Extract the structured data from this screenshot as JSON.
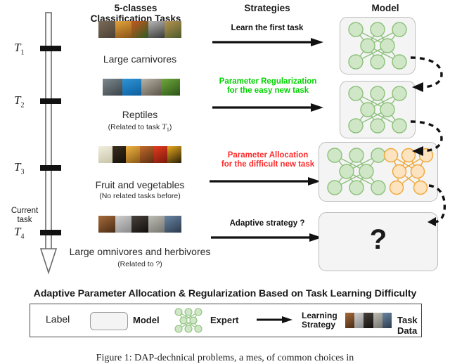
{
  "headers": {
    "tasks": "5-classes\nClassification Tasks",
    "tasks_line1": "5-classes",
    "tasks_line2": "Classification Tasks",
    "strategies": "Strategies",
    "model": "Model"
  },
  "timeline": {
    "current_task_line1": "Current",
    "current_task_line2": "task",
    "ticks": [
      {
        "label": "T",
        "sub": "1"
      },
      {
        "label": "T",
        "sub": "2"
      },
      {
        "label": "T",
        "sub": "3"
      },
      {
        "label": "T",
        "sub": "4"
      }
    ]
  },
  "tasks": [
    {
      "name": "Large carnivores",
      "note": "",
      "thumbs": [
        "#6d5f50",
        "#d08a28",
        "#b24a22",
        "#8c8c8c",
        "#a07f3e"
      ]
    },
    {
      "name": "Reptiles",
      "note": "(Related to task T₁)",
      "note_prefix": "(Related to task ",
      "note_sym": "T",
      "note_sub": "1",
      "note_suffix": ")",
      "thumbs": [
        "#5d6b72",
        "#1f7ec4",
        "#8d8579",
        "#4e7a2c"
      ]
    },
    {
      "name": "Fruit and vegetables",
      "note": "(No related tasks before)",
      "thumbs": [
        "#eceadd",
        "#2a2118",
        "#d9932c",
        "#9d4a22",
        "#cf2a1c",
        "#2a2214"
      ]
    },
    {
      "name": "Large omnivores and herbivores",
      "note": "(Related to ?)",
      "thumbs": [
        "#8a5a34",
        "#b9b9b9",
        "#2f2b28",
        "#a9a9a1",
        "#4d6a86"
      ]
    }
  ],
  "strategies": [
    {
      "lines": [
        "Learn the first task"
      ],
      "color": "#111111"
    },
    {
      "lines": [
        "Parameter Regularization",
        "for the easy new task"
      ],
      "color": "#00d400"
    },
    {
      "lines": [
        "Parameter Allocation",
        "for the difficult new task"
      ],
      "color": "#ff2b2b"
    },
    {
      "lines": [
        "Adaptive strategy ?"
      ],
      "color": "#111111"
    }
  ],
  "models": [
    {
      "experts": [
        {
          "color": "green",
          "layers": [
            3,
            2,
            3
          ]
        }
      ],
      "question": ""
    },
    {
      "experts": [
        {
          "color": "green",
          "layers": [
            3,
            2,
            3
          ]
        }
      ],
      "question": ""
    },
    {
      "experts": [
        {
          "color": "green",
          "layers": [
            3,
            2,
            3
          ]
        },
        {
          "color": "orange",
          "layers": [
            3,
            2,
            2
          ]
        }
      ],
      "question": ""
    },
    {
      "experts": [],
      "question": "?"
    }
  ],
  "colors": {
    "expert_green_fill": "#cfe7c6",
    "expert_green_stroke": "#8cc07a",
    "expert_orange_fill": "#fde3bf",
    "expert_orange_stroke": "#efa838",
    "model_box_bg": "#f4f4f4",
    "model_box_border": "#bdbdbd",
    "strategy_green": "#00d400",
    "strategy_red": "#ff2b2b",
    "arrow_black": "#111111"
  },
  "banner": "Adaptive Parameter Allocation & Regularization Based on Task Learning Difficulty",
  "legend": {
    "label_text": "Label",
    "model_text": "Model",
    "expert_text": "Expert",
    "strategy_line1": "Learning",
    "strategy_line2": "Strategy",
    "taskdata_text": "Task Data",
    "taskdata_thumbs": [
      "#8a5a34",
      "#b9b9b9",
      "#2f2b28",
      "#a9a9a1",
      "#4d6a86"
    ]
  },
  "caption": "Figure 1: DAP-dechnical problems, a mes, of common choices in"
}
